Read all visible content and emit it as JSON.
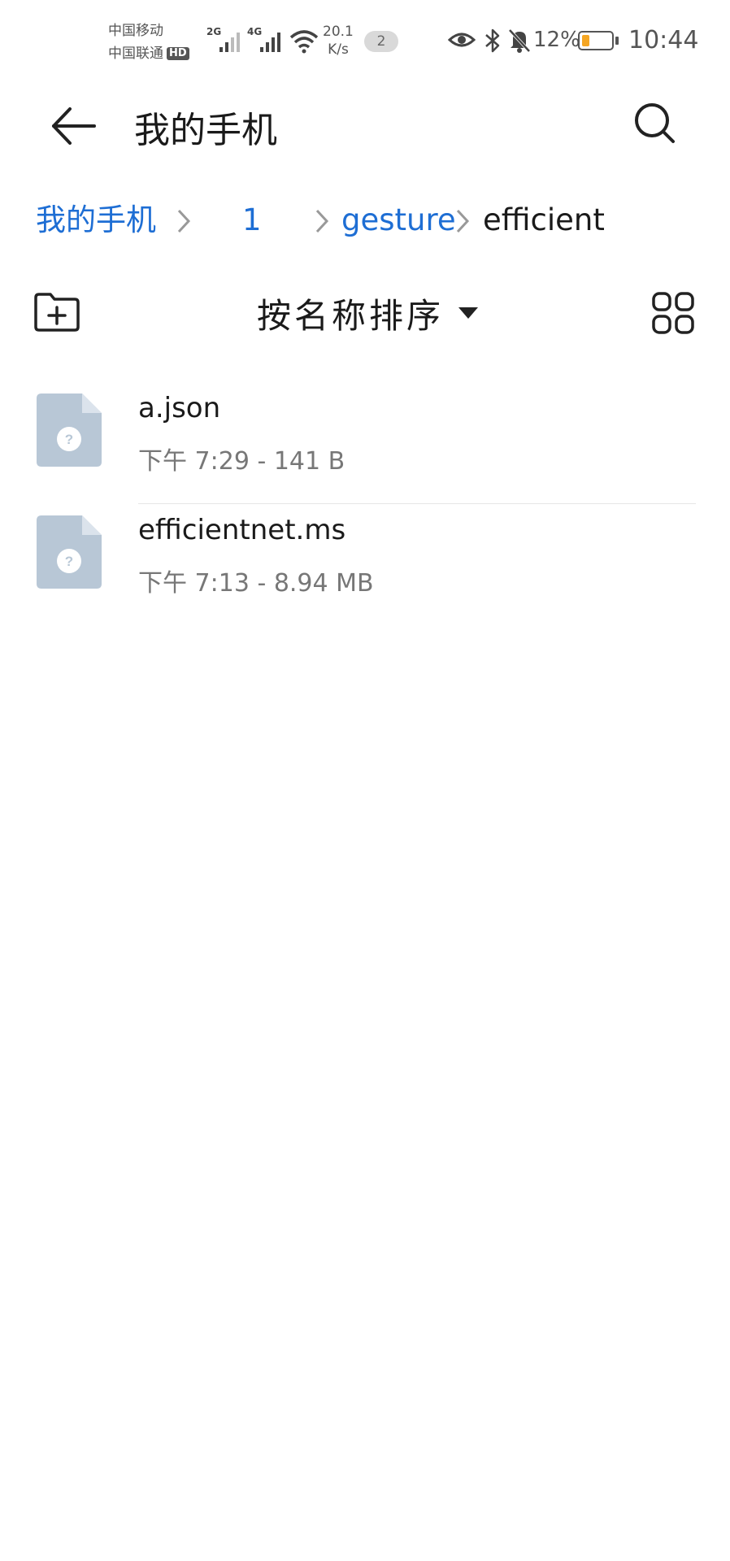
{
  "status_bar": {
    "carrier_1": "中国移动",
    "carrier_2": "中国联通",
    "hd_badge": "HD",
    "sim1_network": "2G",
    "sim2_network": "4G",
    "speed_value": "20.1",
    "speed_unit": "K/s",
    "notification_count": "2",
    "battery_percent": "12%",
    "battery_level": 0.12,
    "battery_color": "#f5a623",
    "time": "10:44"
  },
  "header": {
    "back_icon": "arrow-left-icon",
    "title": "我的手机",
    "search_icon": "search-icon"
  },
  "breadcrumb": {
    "items": [
      "我的手机",
      "1",
      "gesture",
      "efficient"
    ],
    "link_color": "#1e6ed4"
  },
  "toolbar": {
    "new_folder_icon": "folder-plus-icon",
    "sort_label": "按名称排序",
    "view_toggle_icon": "grid-view-icon"
  },
  "files": [
    {
      "name": "a.json",
      "time": "下午 7:29",
      "size": "141 B",
      "icon": "unknown-file-icon"
    },
    {
      "name": "efficientnet.ms",
      "time": "下午 7:13",
      "size": "8.94 MB",
      "icon": "unknown-file-icon"
    }
  ]
}
